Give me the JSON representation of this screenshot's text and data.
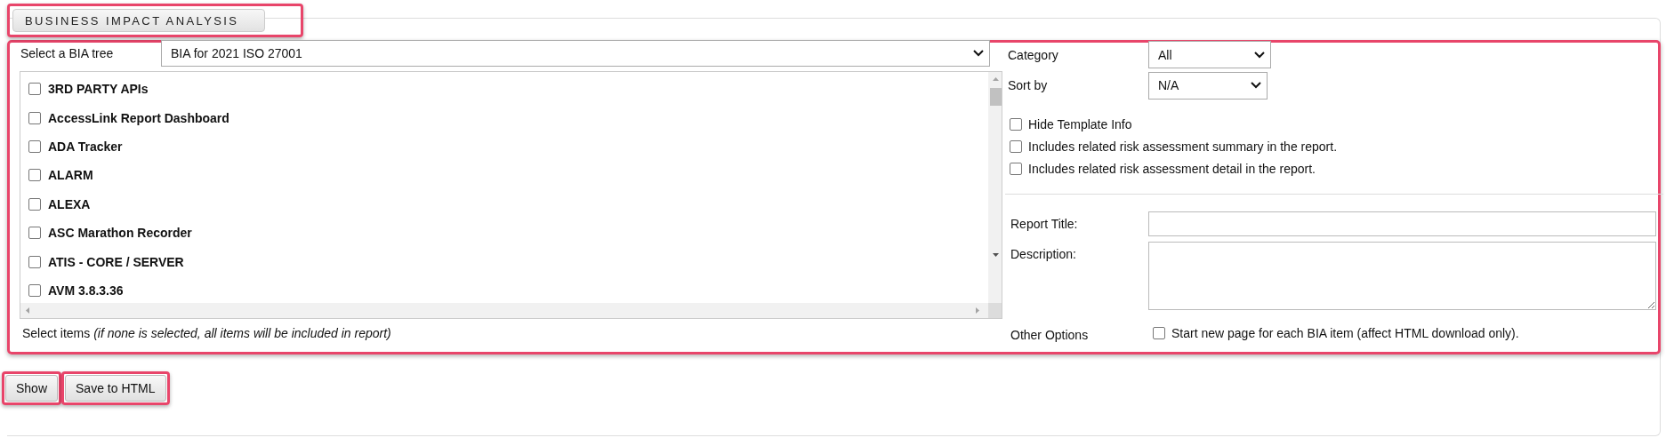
{
  "section_tab": {
    "label": "BUSINESS IMPACT ANALYSIS",
    "highlighted": true
  },
  "panel": {
    "highlighted": true
  },
  "tree_select": {
    "label": "Select a BIA tree",
    "value": "BIA for 2021 ISO 27001"
  },
  "items": [
    {
      "label": "3RD PARTY APIs",
      "checked": false
    },
    {
      "label": "AccessLink Report Dashboard",
      "checked": false
    },
    {
      "label": "ADA Tracker",
      "checked": false
    },
    {
      "label": "ALARM",
      "checked": false
    },
    {
      "label": "ALEXA",
      "checked": false
    },
    {
      "label": "ASC Marathon Recorder",
      "checked": false
    },
    {
      "label": "ATIS - CORE / SERVER",
      "checked": false
    },
    {
      "label": "AVM 3.8.3.36",
      "checked": false
    }
  ],
  "items_hint": {
    "prefix": "Select items",
    "note": "(if none is selected, all items will be included in report)"
  },
  "category": {
    "label": "Category",
    "value": "All"
  },
  "sort_by": {
    "label": "Sort by",
    "value": "N/A"
  },
  "options": [
    {
      "label": "Hide Template Info",
      "checked": false
    },
    {
      "label": "Includes related risk assessment summary in the report.",
      "checked": false
    },
    {
      "label": "Includes related risk assessment detail in the report.",
      "checked": false
    }
  ],
  "report_title": {
    "label": "Report Title:"
  },
  "description": {
    "label": "Description:"
  },
  "other_options": {
    "label": "Other Options",
    "option": {
      "label": "Start new page for each BIA item (affect HTML download only).",
      "checked": false
    }
  },
  "buttons": [
    {
      "label": "Show",
      "highlighted": true
    },
    {
      "label": "Save to HTML",
      "highlighted": true
    }
  ]
}
